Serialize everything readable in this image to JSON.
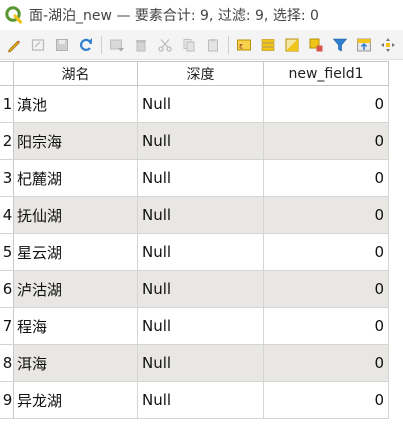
{
  "window": {
    "title": "面-湖泊_new — 要素合计: 9, 过滤: 9, 选择: 0",
    "logo_icon": "qgis-logo-icon"
  },
  "toolbar": {
    "icons": [
      "toggle-editing-icon",
      "toggle-multi-edit-icon",
      "save-edits-icon",
      "reload-icon",
      "add-feature-icon",
      "delete-feature-icon",
      "cut-icon",
      "copy-icon",
      "paste-icon",
      "select-by-expression-icon",
      "select-all-icon",
      "invert-selection-icon",
      "deselect-all-icon",
      "filter-icon",
      "move-selection-to-top-icon",
      "pan-to-selected-icon"
    ]
  },
  "table": {
    "columns": [
      "湖名",
      "深度",
      "new_field1"
    ],
    "rows": [
      {
        "index": "1",
        "name": "滇池",
        "depth": "Null",
        "field1": "0"
      },
      {
        "index": "2",
        "name": "阳宗海",
        "depth": "Null",
        "field1": "0"
      },
      {
        "index": "3",
        "name": "杞麓湖",
        "depth": "Null",
        "field1": "0"
      },
      {
        "index": "4",
        "name": "抚仙湖",
        "depth": "Null",
        "field1": "0"
      },
      {
        "index": "5",
        "name": "星云湖",
        "depth": "Null",
        "field1": "0"
      },
      {
        "index": "6",
        "name": "泸沽湖",
        "depth": "Null",
        "field1": "0"
      },
      {
        "index": "7",
        "name": "程海",
        "depth": "Null",
        "field1": "0"
      },
      {
        "index": "8",
        "name": "洱海",
        "depth": "Null",
        "field1": "0"
      },
      {
        "index": "9",
        "name": "异龙湖",
        "depth": "Null",
        "field1": "0"
      }
    ]
  },
  "colors": {
    "alt_row": "#e9e7e4",
    "qgis_green": "#589632",
    "accent_yellow": "#f0c419"
  }
}
